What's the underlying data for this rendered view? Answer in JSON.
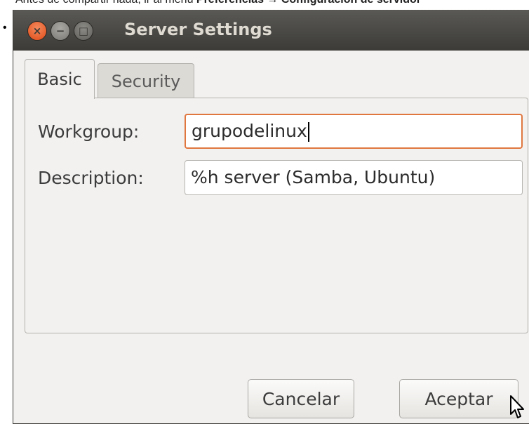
{
  "caption": {
    "prefix": "Antes de compartir nada, ir al menú ",
    "menu_bold": "Preferencias",
    "arrow": " → ",
    "item_bold": "Configuración de servidor"
  },
  "bullet": "•",
  "window": {
    "title": "Server Settings",
    "controls": {
      "close": "×",
      "minimize": "−",
      "maximize": "□"
    }
  },
  "tabs": [
    {
      "label": "Basic",
      "active": true
    },
    {
      "label": "Security",
      "active": false
    }
  ],
  "form": {
    "workgroup_label": "Workgroup:",
    "workgroup_value": "grupodelinux",
    "description_label": "Description:",
    "description_value": "%h server (Samba, Ubuntu)"
  },
  "buttons": {
    "cancel": "Cancelar",
    "ok": "Aceptar"
  },
  "colors": {
    "titlebar": "#3c3b37",
    "close_button": "#df4a16",
    "focus_border": "#e0773f",
    "window_bg": "#f2f1f0"
  }
}
